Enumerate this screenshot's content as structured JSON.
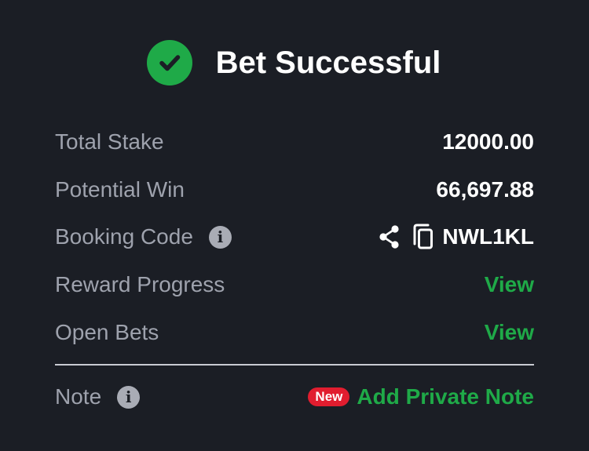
{
  "header": {
    "title": "Bet Successful",
    "icon": "check-circle-icon"
  },
  "colors": {
    "background": "#1b1e25",
    "accent_green": "#1faa48",
    "label_gray": "#9ea2ad",
    "badge_red": "#e11d2f"
  },
  "rows": {
    "total_stake": {
      "label": "Total Stake",
      "value": "12000.00"
    },
    "potential_win": {
      "label": "Potential Win",
      "value": "66,697.88"
    },
    "booking_code": {
      "label": "Booking Code",
      "value": "NWL1KL"
    },
    "reward_progress": {
      "label": "Reward Progress",
      "link": "View"
    },
    "open_bets": {
      "label": "Open Bets",
      "link": "View"
    },
    "note": {
      "label": "Note",
      "badge": "New",
      "link": "Add Private Note"
    }
  }
}
